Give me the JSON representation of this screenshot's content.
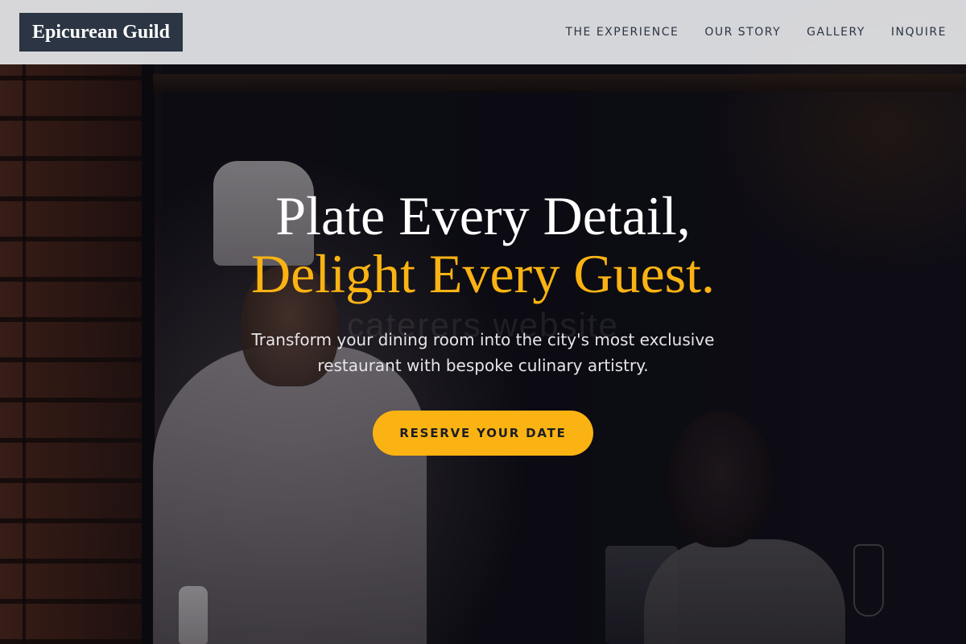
{
  "header": {
    "brand": "Epicurean Guild",
    "nav": [
      {
        "label": "THE EXPERIENCE"
      },
      {
        "label": "OUR STORY"
      },
      {
        "label": "GALLERY"
      },
      {
        "label": "INQUIRE"
      }
    ]
  },
  "hero": {
    "headline_line1": "Plate Every Detail,",
    "headline_line2": "Delight Every Guest.",
    "subtext": "Transform your dining room into the city's most exclusive restaurant with bespoke culinary artistry.",
    "cta_label": "RESERVE YOUR DATE",
    "watermark": "caterers website"
  },
  "colors": {
    "accent": "#fbb313",
    "brand_bg": "#2b3544",
    "nav_text": "#2b3544",
    "nav_bg": "#e2e3e6"
  }
}
